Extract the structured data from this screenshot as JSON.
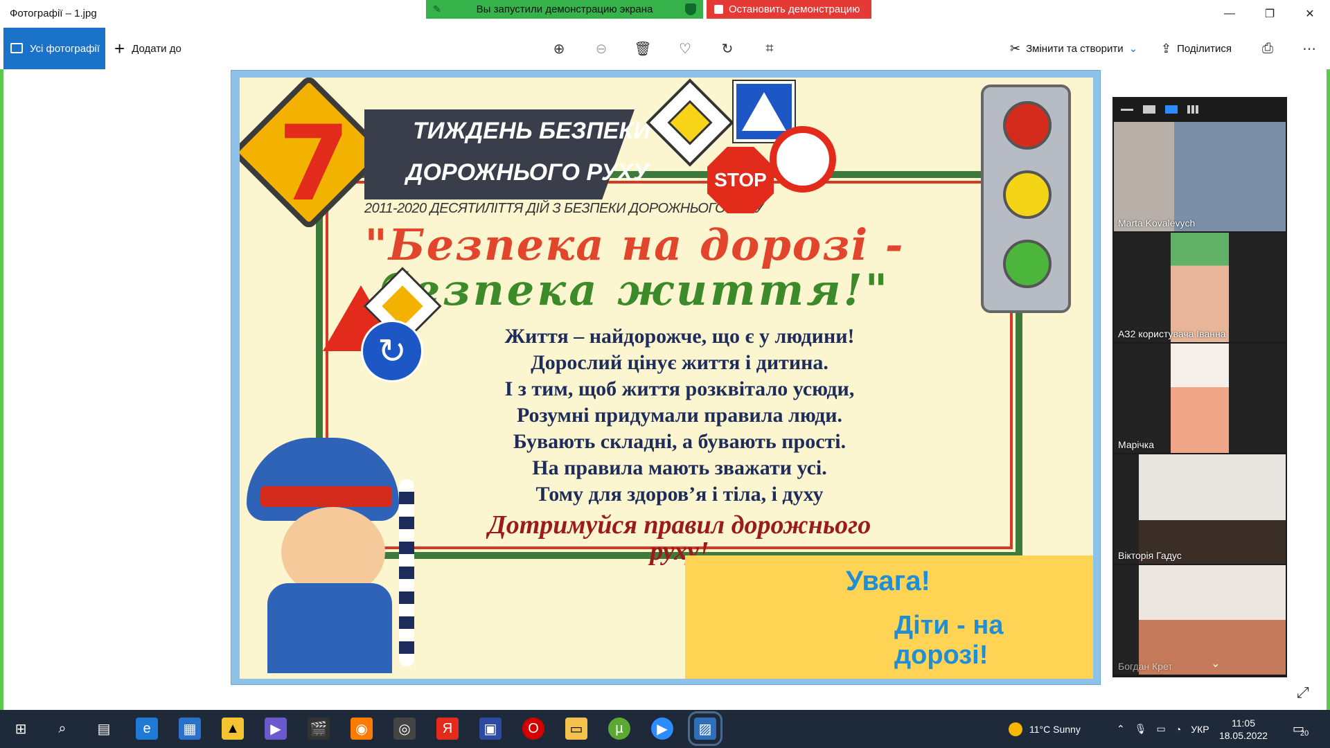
{
  "window": {
    "title": "Фотографії – 1.jpg",
    "share_banner": "Вы запустили демонстрацию экрана",
    "stop_banner": "Остановить демонстрацию"
  },
  "toolbar": {
    "all_photos": "Усі фотографії",
    "add_to": "Додати до",
    "edit_create": "Змінити та створити",
    "share": "Поділитися"
  },
  "poster": {
    "number": "7",
    "banner_line1": "ТИЖДЕНЬ БЕЗПЕКИ",
    "banner_line2": "ДОРОЖНЬОГО РУХУ",
    "subline": "2011-2020 ДЕСЯТИЛІТТЯ ДІЙ З БЕЗПЕКИ ДОРОЖНЬОГО РУХУ",
    "headline1": "\"Безпека на дорозі -",
    "headline2": "безпека життя!\"",
    "poem": [
      "Життя – найдорожче, що є у людини!",
      "Дорослий цінує життя і дитина.",
      "І з тим, щоб життя розквітало усюди,",
      "Розумні придумали правила люди.",
      "Бувають складні, а бувають прості.",
      "На правила мають зважати усі.",
      "Тому для здоров’я і тіла, і духу"
    ],
    "poem_last": "Дотримуйся правил дорожнього руху!",
    "stop_sign": "STOP",
    "uvaga1": "Увага!",
    "uvaga2": "Діти - на дорозі!"
  },
  "participants": [
    {
      "name": "Marta Kovalevych"
    },
    {
      "name": "АЗ2 користувача Іванна"
    },
    {
      "name": "Марічка"
    },
    {
      "name": "Вікторія Гадус"
    },
    {
      "name": "Богдан Крет"
    }
  ],
  "taskbar": {
    "weather": "11°C  Sunny",
    "lang": "УКР",
    "time": "11:05",
    "date": "18.05.2022",
    "notifications": "20"
  },
  "colors": {
    "accent": "#1a73c8",
    "share_green": "#35b24a",
    "stop_red": "#e53935",
    "frame_green": "#5ec84e"
  }
}
